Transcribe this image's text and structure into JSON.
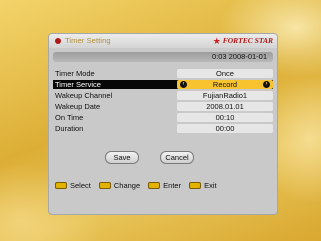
{
  "header": {
    "title": "Timer Setting",
    "brand": "FORTEC STAR"
  },
  "datetime": "0:03 2008-01-01",
  "rows": [
    {
      "label": "Timer Mode",
      "value": "Once"
    },
    {
      "label": "Timer Service",
      "value": "Record"
    },
    {
      "label": "Wakeup Channel",
      "value": "FujianRadio1"
    },
    {
      "label": "Wakeup Date",
      "value": "2008.01.01"
    },
    {
      "label": "On Time",
      "value": "00:10"
    },
    {
      "label": "Duration",
      "value": "00:00"
    }
  ],
  "selected_row": "Timer Service",
  "buttons": {
    "save": "Save",
    "cancel": "Cancel"
  },
  "footer": [
    {
      "label": "Select"
    },
    {
      "label": "Change"
    },
    {
      "label": "Enter"
    },
    {
      "label": "Exit"
    }
  ],
  "colors": {
    "background": "#e2b53a",
    "selected_row": "#070707",
    "selected_value": "#f7c430",
    "brand": "#b01818"
  }
}
